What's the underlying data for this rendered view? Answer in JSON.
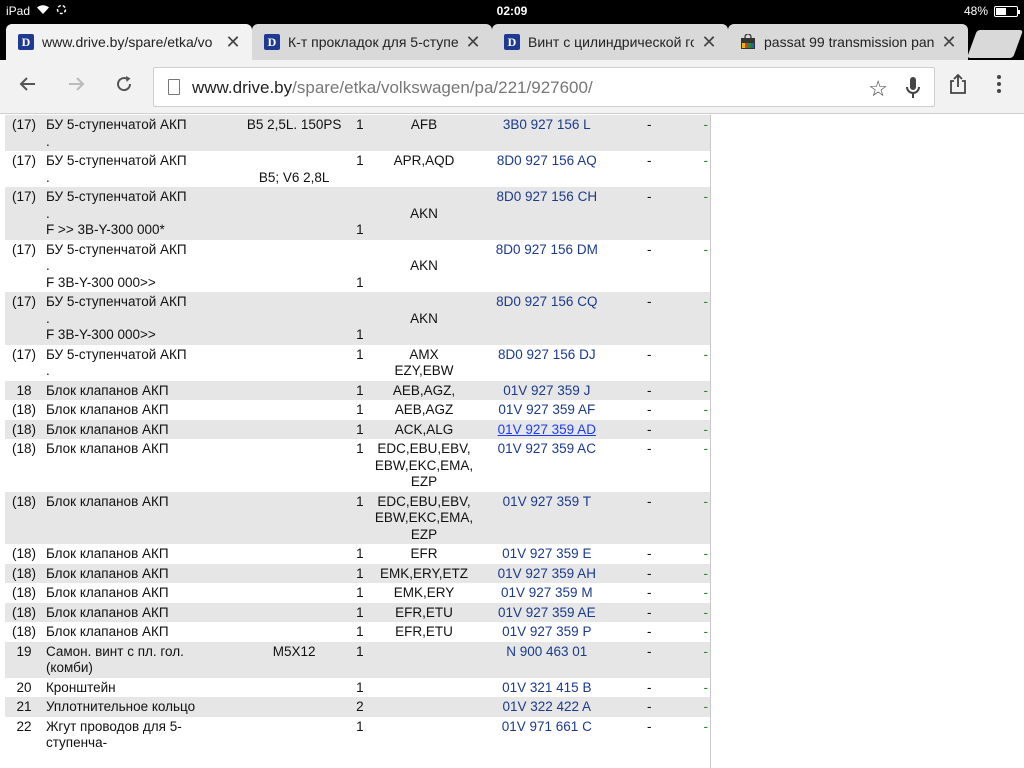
{
  "status": {
    "device": "iPad",
    "time": "02:09",
    "battery": "48%",
    "battery_level": 0.48
  },
  "tabs": [
    {
      "title": "www.drive.by/spare/etka/vo",
      "favicon": "D",
      "active": true
    },
    {
      "title": "К-т прокладок для 5-ступе",
      "favicon": "D",
      "active": false
    },
    {
      "title": "Винт с цилиндрической го",
      "favicon": "D",
      "active": false
    },
    {
      "title": "passat 99 transmission pan",
      "favicon": "shopping-bag",
      "active": false
    }
  ],
  "toolbar": {
    "url_host": "www.drive.by",
    "url_path": "/spare/etka/volkswagen/pa/221/927600/"
  },
  "rows": [
    {
      "pos": "(17)",
      "name": "БУ 5-ступенчатой АКП\n.",
      "rem": "B5 2,5L. 150PS",
      "qty": "1",
      "mod": "AFB",
      "num": "3B0 927 156 L",
      "d": "-",
      "g": "-"
    },
    {
      "pos": "(17)",
      "name": "БУ 5-ступенчатой АКП\n.",
      "rem": "\nB5; V6 2,8L",
      "qty": "1",
      "mod": "APR,AQD",
      "num": "8D0 927 156 AQ",
      "d": "-",
      "g": "-"
    },
    {
      "pos": "(17)",
      "name": "БУ 5-ступенчатой АКП\n.\nF >> 3B-Y-300 000*",
      "rem": "",
      "qty": "\n\n1",
      "mod": "\nAKN",
      "num": "8D0 927 156 CH",
      "d": "-",
      "g": "-"
    },
    {
      "pos": "(17)",
      "name": "БУ 5-ступенчатой АКП\n.\nF 3B-Y-300 000>>",
      "rem": "",
      "qty": "\n\n1",
      "mod": "\nAKN",
      "num": "8D0 927 156 DM",
      "d": "-",
      "g": "-"
    },
    {
      "pos": "(17)",
      "name": "БУ 5-ступенчатой АКП\n.\nF 3B-Y-300 000>>",
      "rem": "",
      "qty": "\n\n1",
      "mod": "\nAKN",
      "num": "8D0 927 156 CQ",
      "d": "-",
      "g": "-"
    },
    {
      "pos": "(17)",
      "name": "БУ 5-ступенчатой АКП\n.",
      "rem": "",
      "qty": "1",
      "mod": "AMX\nEZY,EBW",
      "num": "8D0 927 156 DJ",
      "d": "-",
      "g": "-"
    },
    {
      "pos": "18",
      "name": "Блок клапанов АКП",
      "rem": "",
      "qty": "1",
      "mod": "AEB,AGZ,",
      "num": "01V 927 359 J",
      "d": "-",
      "g": "-"
    },
    {
      "pos": "(18)",
      "name": "Блок клапанов АКП",
      "rem": "",
      "qty": "1",
      "mod": "AEB,AGZ",
      "num": "01V 927 359 AF",
      "d": "-",
      "g": "-"
    },
    {
      "pos": "(18)",
      "name": "Блок клапанов АКП",
      "rem": "",
      "qty": "1",
      "mod": "ACK,ALG",
      "num": "01V 927 359 AD",
      "d": "-",
      "g": "-",
      "hover": true
    },
    {
      "pos": "(18)",
      "name": "Блок клапанов АКП",
      "rem": "",
      "qty": "1",
      "mod": "EDC,EBU,EBV,\nEBW,EKC,EMA,\nEZP",
      "num": "01V 927 359 AC",
      "d": "-",
      "g": "-"
    },
    {
      "pos": "(18)",
      "name": "Блок клапанов АКП",
      "rem": "",
      "qty": "1",
      "mod": "EDC,EBU,EBV,\nEBW,EKC,EMA,\nEZP",
      "num": "01V 927 359 T",
      "d": "-",
      "g": "-"
    },
    {
      "pos": "(18)",
      "name": "Блок клапанов АКП",
      "rem": "",
      "qty": "1",
      "mod": "EFR",
      "num": "01V 927 359 E",
      "d": "-",
      "g": "-"
    },
    {
      "pos": "(18)",
      "name": "Блок клапанов АКП",
      "rem": "",
      "qty": "1",
      "mod": "EMK,ERY,ETZ",
      "num": "01V 927 359 AH",
      "d": "-",
      "g": "-"
    },
    {
      "pos": "(18)",
      "name": "Блок клапанов АКП",
      "rem": "",
      "qty": "1",
      "mod": "EMK,ERY",
      "num": "01V 927 359 M",
      "d": "-",
      "g": "-"
    },
    {
      "pos": "(18)",
      "name": "Блок клапанов АКП",
      "rem": "",
      "qty": "1",
      "mod": "EFR,ETU",
      "num": "01V 927 359 AE",
      "d": "-",
      "g": "-"
    },
    {
      "pos": "(18)",
      "name": "Блок клапанов АКП",
      "rem": "",
      "qty": "1",
      "mod": "EFR,ETU",
      "num": "01V 927 359 P",
      "d": "-",
      "g": "-"
    },
    {
      "pos": "19",
      "name": "Самон. винт с пл. гол.\n(комби)",
      "rem": "M5X12",
      "qty": "1",
      "mod": "",
      "num": "N 900 463 01",
      "d": "-",
      "g": "-"
    },
    {
      "pos": "20",
      "name": "Кронштейн",
      "rem": "",
      "qty": "1",
      "mod": "",
      "num": "01V 321 415 B",
      "d": "-",
      "g": "-"
    },
    {
      "pos": "21",
      "name": "Уплотнительное кольцо",
      "rem": "",
      "qty": "2",
      "mod": "",
      "num": "01V 322 422 A",
      "d": "-",
      "g": "-"
    },
    {
      "pos": "22",
      "name": "Жгут проводов для 5-\nступенча-",
      "rem": "",
      "qty": "1",
      "mod": "",
      "num": "01V 971 661 C",
      "d": "-",
      "g": "-"
    }
  ]
}
